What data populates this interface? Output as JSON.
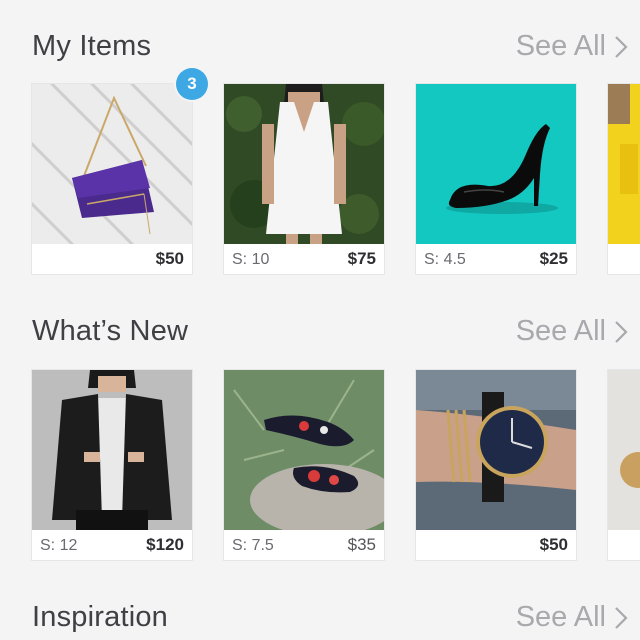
{
  "sections": [
    {
      "title": "My Items",
      "see_all": "See All",
      "badge": "3",
      "items": [
        {
          "image": "purple-clutch-bag",
          "size": "",
          "price": "$50"
        },
        {
          "image": "white-dress",
          "size": "S: 10",
          "price": "$75"
        },
        {
          "image": "black-heel",
          "size": "S: 4.5",
          "price": "$25"
        },
        {
          "image": "yellow-item-partial",
          "size": "",
          "price": ""
        }
      ]
    },
    {
      "title": "What’s New",
      "see_all": "See All",
      "items": [
        {
          "image": "black-leather-blazer",
          "size": "S: 12",
          "price": "$120"
        },
        {
          "image": "floral-flats",
          "size": "S: 7.5",
          "price": "$35"
        },
        {
          "image": "wrist-watch",
          "size": "",
          "price": "$50"
        },
        {
          "image": "partial-item",
          "size": "",
          "price": ""
        }
      ]
    },
    {
      "title": "Inspiration",
      "see_all": "See All"
    }
  ],
  "colors": {
    "background": "#f4f4f5",
    "title_text": "#3f3f44",
    "see_all_text": "#a9a9ad",
    "badge": "#3ea8e4"
  }
}
